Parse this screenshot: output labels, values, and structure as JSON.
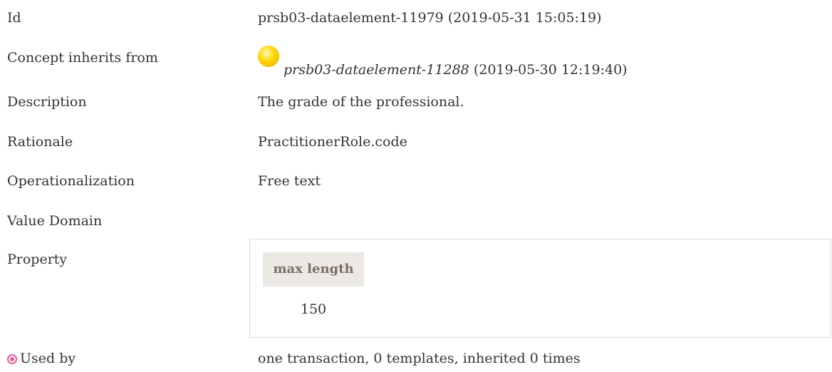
{
  "rows": {
    "id": {
      "label": "Id",
      "value": "prsb03-dataelement-11979 (2019-05-31 15:05:19)"
    },
    "inherits": {
      "label": "Concept inherits from",
      "link": "prsb03-dataelement-11288",
      "date": " (2019-05-30 12:19:40)",
      "icon": "yellow-dot-icon"
    },
    "description": {
      "label": "Description",
      "value": "The grade of the professional."
    },
    "rationale": {
      "label": "Rationale",
      "value": "PractitionerRole.code"
    },
    "operationalization": {
      "label": "Operationalization",
      "value": "Free text"
    },
    "value_domain": {
      "label": "Value Domain"
    },
    "property": {
      "label": "Property",
      "header": "max length",
      "value": "150"
    },
    "used_by": {
      "label": "Used by",
      "value": "one transaction, 0 templates, inherited 0 times",
      "icon": "target-icon"
    }
  },
  "colors": {
    "text": "#333333",
    "header_bg": "#ece9e4",
    "header_text": "#7a6e63",
    "box_border": "#dddddd",
    "target_icon": "#e85d9a",
    "dot": "#ffd500"
  }
}
